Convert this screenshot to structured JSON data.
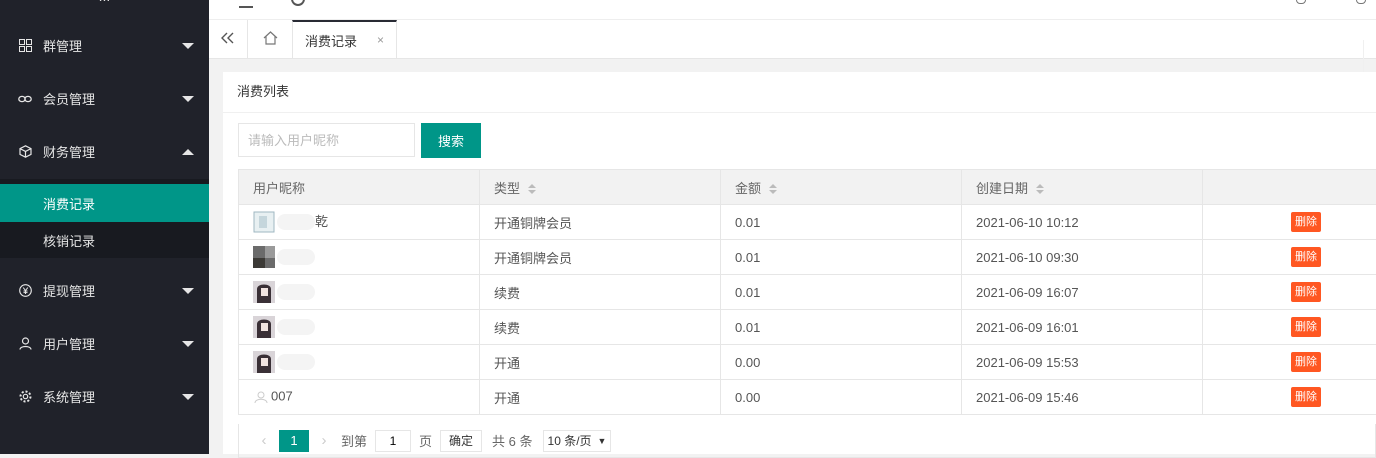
{
  "sidebar": {
    "brand": "...",
    "items": [
      {
        "label": "群管理",
        "icon": "grid-icon"
      },
      {
        "label": "会员管理",
        "icon": "link-icon"
      },
      {
        "label": "财务管理",
        "icon": "cube-icon"
      },
      {
        "label": "提现管理",
        "icon": "yen-icon"
      },
      {
        "label": "用户管理",
        "icon": "user-icon"
      },
      {
        "label": "系统管理",
        "icon": "gear-icon"
      }
    ],
    "sub_items": [
      {
        "label": "消费记录",
        "active": true
      },
      {
        "label": "核销记录",
        "active": false
      }
    ]
  },
  "tabs": {
    "active_label": "消费记录",
    "close_label": "×"
  },
  "card": {
    "title": "消费列表",
    "search_placeholder": "请输入用户昵称",
    "search_label": "搜索"
  },
  "table": {
    "headers": [
      "用户昵称",
      "类型",
      "金额",
      "创建日期",
      ""
    ],
    "rows": [
      {
        "nickname": "乾",
        "type": "开通铜牌会员",
        "amount": "0.01",
        "date": "2021-06-10 10:12",
        "action": "删除"
      },
      {
        "nickname": "",
        "type": "开通铜牌会员",
        "amount": "0.01",
        "date": "2021-06-10 09:30",
        "action": "删除"
      },
      {
        "nickname": "",
        "type": "续费",
        "amount": "0.01",
        "date": "2021-06-09 16:07",
        "action": "删除"
      },
      {
        "nickname": "",
        "type": "续费",
        "amount": "0.01",
        "date": "2021-06-09 16:01",
        "action": "删除"
      },
      {
        "nickname": "",
        "type": "开通",
        "amount": "0.00",
        "date": "2021-06-09 15:53",
        "action": "删除"
      },
      {
        "nickname": "007",
        "type": "开通",
        "amount": "0.00",
        "date": "2021-06-09 15:46",
        "action": "删除"
      }
    ]
  },
  "pager": {
    "prev": "‹",
    "current": "1",
    "next": "›",
    "goto_label": "到第",
    "goto_value": "1",
    "page_unit": "页",
    "confirm_label": "确定",
    "total_label": "共 6 条",
    "page_size": "10 条/页"
  },
  "colors": {
    "sidebar_bg": "#20222a",
    "accent": "#009688",
    "danger": "#ff5722"
  }
}
